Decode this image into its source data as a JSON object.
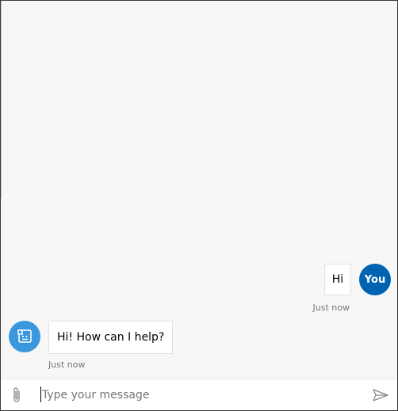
{
  "transcript": {
    "user_message": {
      "text": "Hi",
      "avatar_initials": "You",
      "timestamp": "Just now"
    },
    "bot_message": {
      "text": "Hi! How can I help?",
      "avatar_icon": "bot-icon",
      "timestamp": "Just now"
    }
  },
  "sendbox": {
    "value": "",
    "placeholder": "Type your message",
    "attach_icon": "paperclip-icon",
    "send_icon": "send-icon"
  },
  "colors": {
    "user_avatar": "#0063b1",
    "bot_avatar": "#3a96dd",
    "transcript_background": "#f7f7f7",
    "timestamp_text": "#767676"
  }
}
